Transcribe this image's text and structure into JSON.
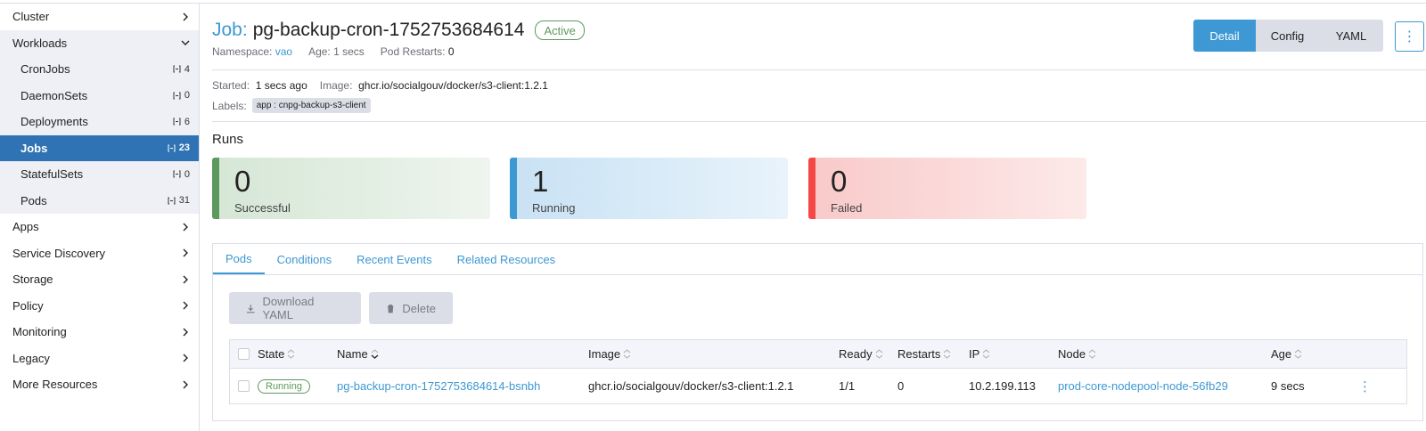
{
  "sidebar": {
    "items": [
      {
        "label": "Cluster",
        "icon": "chevron-right-icon"
      },
      {
        "label": "Workloads",
        "icon": "chevron-down-icon"
      },
      {
        "label": "Apps",
        "icon": "chevron-right-icon"
      },
      {
        "label": "Service Discovery",
        "icon": "chevron-right-icon"
      },
      {
        "label": "Storage",
        "icon": "chevron-right-icon"
      },
      {
        "label": "Policy",
        "icon": "chevron-right-icon"
      },
      {
        "label": "Monitoring",
        "icon": "chevron-right-icon"
      },
      {
        "label": "Legacy",
        "icon": "chevron-right-icon"
      },
      {
        "label": "More Resources",
        "icon": "chevron-right-icon"
      }
    ],
    "workloads": [
      {
        "label": "CronJobs",
        "count": "4"
      },
      {
        "label": "DaemonSets",
        "count": "0"
      },
      {
        "label": "Deployments",
        "count": "6"
      },
      {
        "label": "Jobs",
        "count": "23",
        "active": true
      },
      {
        "label": "StatefulSets",
        "count": "0"
      },
      {
        "label": "Pods",
        "count": "31"
      }
    ]
  },
  "header": {
    "kind": "Job:",
    "name": "pg-backup-cron-1752753684614",
    "state": "Active",
    "namespace_label": "Namespace:",
    "namespace": "vao",
    "age_label": "Age:",
    "age": "1 secs",
    "restarts_label": "Pod Restarts:",
    "restarts": "0",
    "views": [
      "Detail",
      "Config",
      "YAML"
    ],
    "active_view": "Detail",
    "kebab": "⋮"
  },
  "info": {
    "started_label": "Started:",
    "started": "1 secs ago",
    "image_label": "Image:",
    "image": "ghcr.io/socialgouv/docker/s3-client:1.2.1",
    "labels_label": "Labels:",
    "label_chip": "app : cnpg-backup-s3-client"
  },
  "runs": {
    "title": "Runs",
    "successful": {
      "count": "0",
      "label": "Successful"
    },
    "running": {
      "count": "1",
      "label": "Running"
    },
    "failed": {
      "count": "0",
      "label": "Failed"
    }
  },
  "tabs": [
    "Pods",
    "Conditions",
    "Recent Events",
    "Related Resources"
  ],
  "actions": {
    "download": "Download YAML",
    "delete": "Delete"
  },
  "table": {
    "headers": {
      "state": "State",
      "name": "Name",
      "image": "Image",
      "ready": "Ready",
      "restarts": "Restarts",
      "ip": "IP",
      "node": "Node",
      "age": "Age"
    },
    "rows": [
      {
        "state": "Running",
        "name": "pg-backup-cron-1752753684614-bsnbh",
        "image": "ghcr.io/socialgouv/docker/s3-client:1.2.1",
        "ready": "1/1",
        "restarts": "0",
        "ip": "10.2.199.113",
        "node": "prod-core-nodepool-node-56fb29",
        "age": "9 secs",
        "menu": "⋮"
      }
    ]
  },
  "colors": {
    "accent": "#3d98d3",
    "success": "#5d995d",
    "error": "#f64747",
    "nav_active": "#2f73b4"
  }
}
